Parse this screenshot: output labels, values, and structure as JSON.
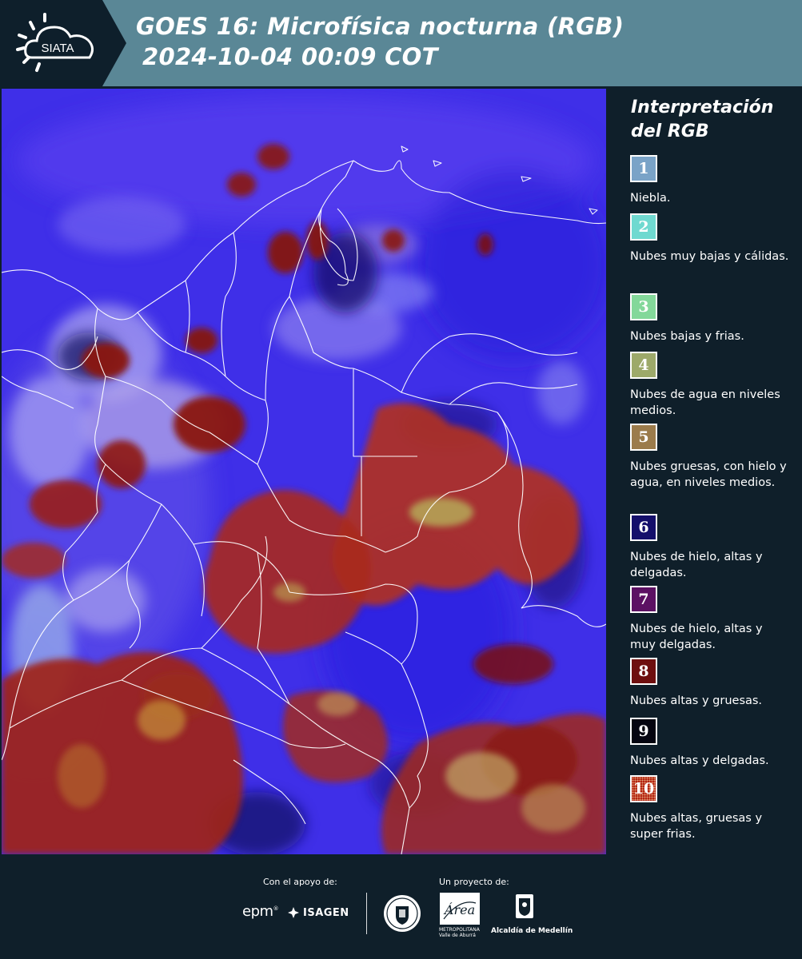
{
  "header": {
    "logo_text": "SIATA",
    "title_line1": "GOES 16: Microfísica nocturna (RGB)",
    "title_line2": "2024-10-04 00:09 COT"
  },
  "map": {
    "base_color": "#3f2fe8",
    "border_color": "#ffffff"
  },
  "legend": {
    "title": "Interpretación del RGB",
    "items": [
      {
        "number": "1",
        "color": "#7aa3c7",
        "label": "Niebla."
      },
      {
        "number": "2",
        "color": "#6fd9d0",
        "label": "Nubes muy bajas y cálidas."
      },
      {
        "number": "3",
        "color": "#83d89a",
        "label": "Nubes bajas y frias."
      },
      {
        "number": "4",
        "color": "#9da96a",
        "label": "Nubes de agua en niveles medios."
      },
      {
        "number": "5",
        "color": "#9b7b4b",
        "label": "Nubes gruesas, con hielo y agua, en niveles medios."
      },
      {
        "number": "6",
        "color": "#140f6b",
        "label": "Nubes de hielo, altas y delgadas."
      },
      {
        "number": "7",
        "color": "#5c1163",
        "label": "Nubes de hielo, altas y muy delgadas."
      },
      {
        "number": "8",
        "color": "#6e0f0f",
        "label": "Nubes altas y gruesas."
      },
      {
        "number": "9",
        "color": "#050510",
        "label": "Nubes altas y delgadas."
      },
      {
        "number": "10",
        "color": "#b2200f",
        "label": "Nubes altas, gruesas y super frias."
      }
    ]
  },
  "footer": {
    "support_label": "Con el apoyo de:",
    "project_label": "Un proyecto de:",
    "sponsor1": "epm",
    "sponsor1_mark": "®",
    "sponsor2": "ISAGEN",
    "area_name": "Área",
    "area_sub1": "METROPOLITANA",
    "area_sub2": "Valle de Aburrá",
    "alcaldia": "Alcaldía de Medellín"
  }
}
